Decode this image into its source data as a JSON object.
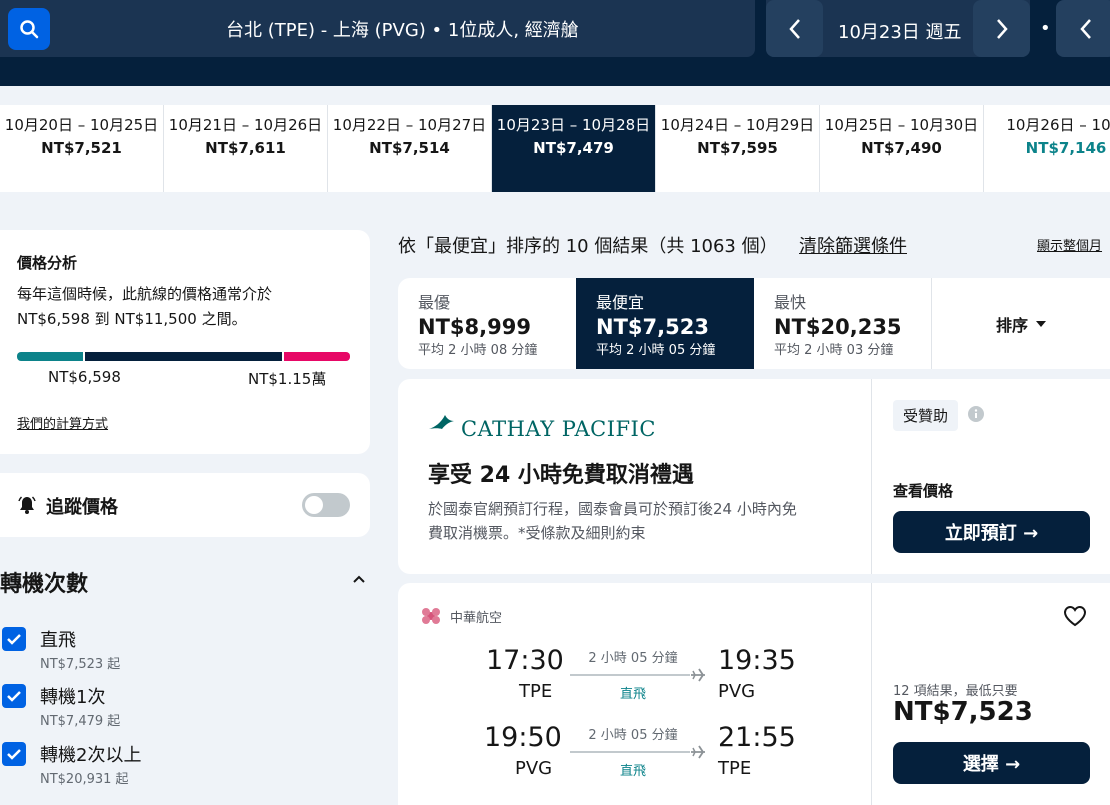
{
  "header": {
    "route": "台北 (TPE) - 上海 (PVG) • 1位成人, 經濟艙",
    "date": "10月23日 週五",
    "dot": "•"
  },
  "date_strip": [
    {
      "range": "10月20日 – 10月25日",
      "price": "NT$7,521"
    },
    {
      "range": "10月21日 – 10月26日",
      "price": "NT$7,611"
    },
    {
      "range": "10月22日 – 10月27日",
      "price": "NT$7,514"
    },
    {
      "range": "10月23日 – 10月28日",
      "price": "NT$7,479"
    },
    {
      "range": "10月24日 – 10月29日",
      "price": "NT$7,595"
    },
    {
      "range": "10月25日 – 10月30日",
      "price": "NT$7,490"
    },
    {
      "range": "10月26日 – 10月",
      "price": "NT$7,146"
    }
  ],
  "price_analysis": {
    "title": "價格分析",
    "desc1": "每年這個時候，此航線的價格通常介於",
    "desc2": "NT$6,598 到 NT$11,500 之間。",
    "low_label": "NT$6,598",
    "high_label": "NT$1.15萬",
    "colors": {
      "low": "#0c838a",
      "mid": "#05203c",
      "high": "#e70866"
    },
    "link": "我們的計算方式"
  },
  "track": {
    "label": "追蹤價格",
    "on": false
  },
  "stops": {
    "title": "轉機次數",
    "options": [
      {
        "label": "直飛",
        "sub": "NT$7,523 起",
        "checked": true
      },
      {
        "label": "轉機1次",
        "sub": "NT$7,479 起",
        "checked": true
      },
      {
        "label": "轉機2次以上",
        "sub": "NT$20,931 起",
        "checked": true
      }
    ]
  },
  "results": {
    "summary": "依「最便宜」排序的 10 個結果（共 1063 個）",
    "clear": "清除篩選條件",
    "show_month": "顯示整個月"
  },
  "sort_tabs": [
    {
      "title": "最優",
      "price": "NT$8,999",
      "sub": "平均 2 小時 08 分鐘"
    },
    {
      "title": "最便宜",
      "price": "NT$7,523",
      "sub": "平均 2 小時 05 分鐘"
    },
    {
      "title": "最快",
      "price": "NT$20,235",
      "sub": "平均 2 小時 03 分鐘"
    }
  ],
  "sort_button": "排序",
  "ad": {
    "brand": "CATHAY PACIFIC",
    "headline": "享受 24 小時免費取消禮遇",
    "body1": "於國泰官網預訂行程，國泰會員可於預訂後24 小時內免",
    "body2": "費取消機票。*受條款及細則約束",
    "sponsored": "受贊助",
    "check_price": "查看價格",
    "cta": "立即預訂 →"
  },
  "flight": {
    "airline": "中華航空",
    "legs": [
      {
        "dep": "17:30",
        "dep_code": "TPE",
        "dur": "2 小時 05 分鐘",
        "type": "直飛",
        "arr": "19:35",
        "arr_code": "PVG"
      },
      {
        "dep": "19:50",
        "dep_code": "PVG",
        "dur": "2 小時 05 分鐘",
        "type": "直飛",
        "arr": "21:55",
        "arr_code": "TPE"
      }
    ],
    "results_note": "12 項結果，最低只要",
    "price": "NT$7,523",
    "select": "選擇 →"
  }
}
